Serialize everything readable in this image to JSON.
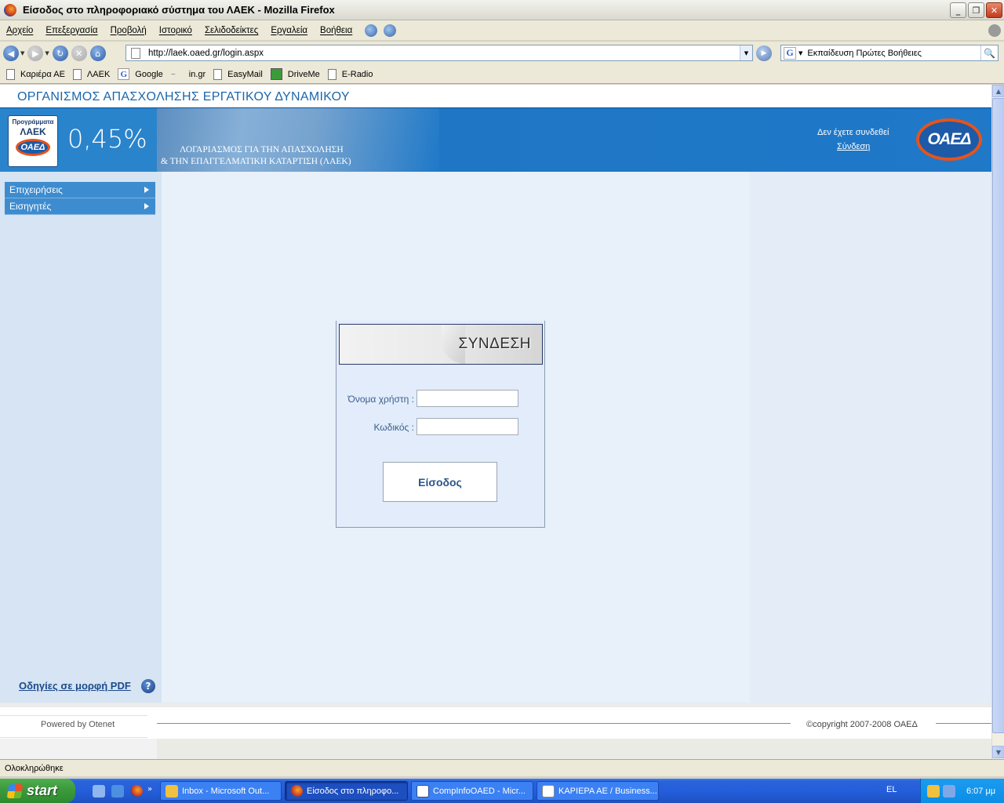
{
  "window": {
    "title": "Είσοδος στο πληροφοριακό σύστημα του ΛΑΕΚ - Mozilla Firefox",
    "minimize": "_",
    "restore": "❐",
    "close": "✕"
  },
  "menubar": {
    "items": [
      "Αρχείο",
      "Επεξεργασία",
      "Προβολή",
      "Ιστορικό",
      "Σελιδοδείκτες",
      "Εργαλεία",
      "Βοήθεια"
    ]
  },
  "navbar": {
    "url": "http://laek.oaed.gr/login.aspx",
    "search_text": "Εκπαίδευση Πρώτες Βοήθειες",
    "search_engine_letter": "G"
  },
  "bookmarks": [
    "Καριέρα ΑΕ",
    "ΛΑΕΚ",
    "Google",
    "in.gr",
    "EasyMail",
    "DriveMe",
    "E-Radio"
  ],
  "site": {
    "org_title": "ΟΡΓΑΝΙΣΜΟΣ ΑΠΑΣΧΟΛΗΣΗΣ ΕΡΓΑΤΙΚΟΥ ΔΥΝΑΜΙΚΟΥ",
    "logo_line1": "Προγράμματα",
    "logo_line2": "ΛΑΕΚ",
    "logo_oval": "ΟΑΕΔ",
    "percent": "0,45%",
    "account_line1": "ΛΟΓΑΡΙΑΣΜΟΣ ΓΙΑ ΤΗΝ ΑΠΑΣΧΟΛΗΣΗ",
    "account_line2": "& ΤΗΝ ΕΠΑΓΓΕΛΜΑΤΙΚΗ ΚΑΤΑΡΤΙΣΗ (ΛΑΕΚ)",
    "not_logged": "Δεν έχετε συνδεθεί",
    "login_link": "Σύνδεση",
    "oaed_logo": "ΟΑΕΔ"
  },
  "sidebar": {
    "items": [
      {
        "label": "Επιχειρήσεις"
      },
      {
        "label": "Εισηγητές"
      }
    ],
    "pdf_link": "Οδηγίες σε μορφή PDF",
    "help_glyph": "?"
  },
  "login": {
    "header": "ΣΥΝΔΕΣΗ",
    "username_label": "Όνομα χρήστη :",
    "password_label": "Κωδικός :",
    "username_value": "",
    "password_value": "",
    "submit": "Είσοδος"
  },
  "footer": {
    "powered": "Powered by Otenet",
    "copyright": "©copyright 2007-2008 ΟΑΕΔ"
  },
  "status": {
    "text": "Ολοκληρώθηκε"
  },
  "taskbar": {
    "start": "start",
    "tasks": [
      {
        "label": "Inbox - Microsoft Out..."
      },
      {
        "label": "Είσοδος στο πληροφο..."
      },
      {
        "label": "CompInfoOAED - Micr..."
      },
      {
        "label": "ΚΑΡΙΕΡΑ ΑΕ / Business..."
      }
    ],
    "language": "EL",
    "clock": "6:07 μμ"
  }
}
